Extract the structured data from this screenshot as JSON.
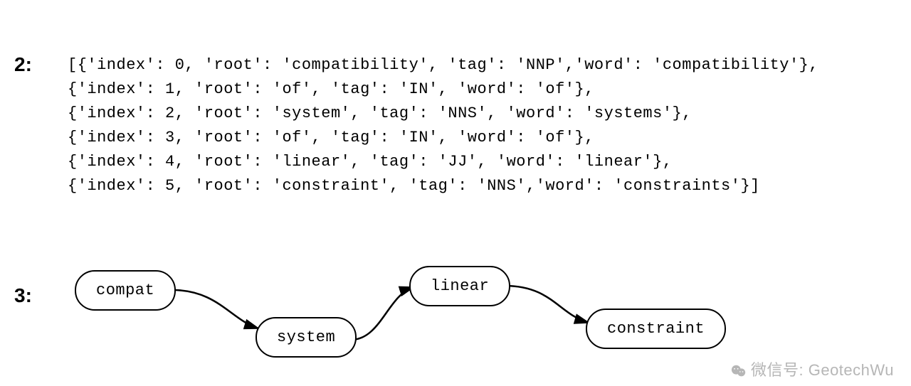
{
  "labels": {
    "section2": "2:",
    "section3": "3:"
  },
  "code": {
    "line0": "[{'index': 0, 'root': 'compatibility', 'tag': 'NNP','word': 'compatibility'},",
    "line1": " {'index': 1, 'root': 'of', 'tag': 'IN', 'word': 'of'},",
    "line2": " {'index': 2, 'root': 'system', 'tag': 'NNS', 'word': 'systems'},",
    "line3": " {'index': 3, 'root': 'of', 'tag': 'IN', 'word': 'of'},",
    "line4": " {'index': 4, 'root': 'linear', 'tag': 'JJ', 'word': 'linear'},",
    "line5": " {'index': 5, 'root': 'constraint', 'tag': 'NNS','word': 'constraints'}]"
  },
  "tokens": [
    {
      "index": 0,
      "root": "compatibility",
      "tag": "NNP",
      "word": "compatibility"
    },
    {
      "index": 1,
      "root": "of",
      "tag": "IN",
      "word": "of"
    },
    {
      "index": 2,
      "root": "system",
      "tag": "NNS",
      "word": "systems"
    },
    {
      "index": 3,
      "root": "of",
      "tag": "IN",
      "word": "of"
    },
    {
      "index": 4,
      "root": "linear",
      "tag": "JJ",
      "word": "linear"
    },
    {
      "index": 5,
      "root": "constraint",
      "tag": "NNS",
      "word": "constraints"
    }
  ],
  "diagram": {
    "nodes": {
      "n1": "compat",
      "n2": "system",
      "n3": "linear",
      "n4": "constraint"
    },
    "edges": [
      {
        "from": "n1",
        "to": "n2"
      },
      {
        "from": "n2",
        "to": "n3"
      },
      {
        "from": "n3",
        "to": "n4"
      }
    ]
  },
  "watermark": {
    "text": "微信号: GeotechWu"
  }
}
